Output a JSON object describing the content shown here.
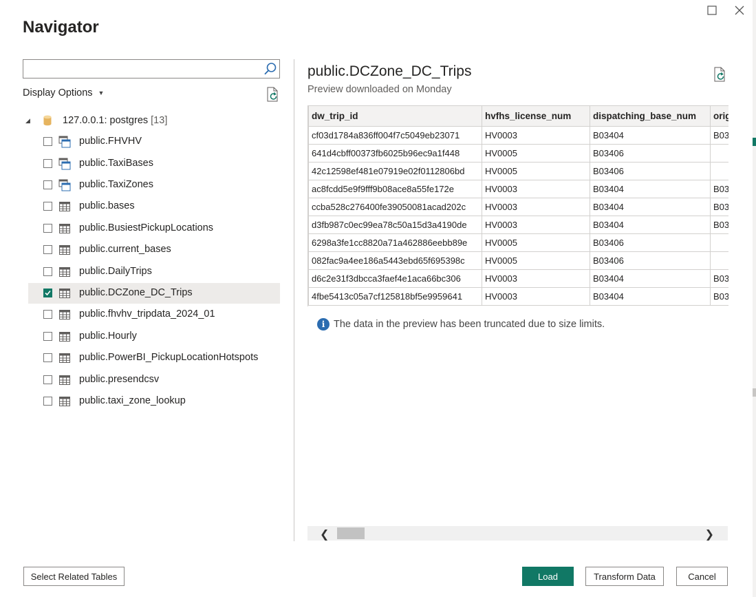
{
  "dialog": {
    "title": "Navigator"
  },
  "search": {
    "value": "",
    "placeholder": ""
  },
  "display_options": {
    "label": "Display Options"
  },
  "tree": {
    "root": {
      "label": "127.0.0.1: postgres",
      "count": "[13]"
    },
    "items": [
      {
        "label": "public.FHVHV",
        "icon": "view-icon",
        "checked": false
      },
      {
        "label": "public.TaxiBases",
        "icon": "view-icon",
        "checked": false
      },
      {
        "label": "public.TaxiZones",
        "icon": "view-icon",
        "checked": false
      },
      {
        "label": "public.bases",
        "icon": "table-icon",
        "checked": false
      },
      {
        "label": "public.BusiestPickupLocations",
        "icon": "table-icon",
        "checked": false
      },
      {
        "label": "public.current_bases",
        "icon": "table-icon",
        "checked": false
      },
      {
        "label": "public.DailyTrips",
        "icon": "table-icon",
        "checked": false
      },
      {
        "label": "public.DCZone_DC_Trips",
        "icon": "table-icon",
        "checked": true
      },
      {
        "label": "public.fhvhv_tripdata_2024_01",
        "icon": "table-icon",
        "checked": false
      },
      {
        "label": "public.Hourly",
        "icon": "table-icon",
        "checked": false
      },
      {
        "label": "public.PowerBI_PickupLocationHotspots",
        "icon": "table-icon",
        "checked": false
      },
      {
        "label": "public.presendcsv",
        "icon": "table-icon",
        "checked": false
      },
      {
        "label": "public.taxi_zone_lookup",
        "icon": "table-icon",
        "checked": false
      }
    ]
  },
  "preview": {
    "title": "public.DCZone_DC_Trips",
    "subtitle": "Preview downloaded on Monday",
    "columns": [
      "dw_trip_id",
      "hvfhs_license_num",
      "dispatching_base_num",
      "orig"
    ],
    "rows": [
      [
        "cf03d1784a836ff004f7c5049eb23071",
        "HV0003",
        "B03404",
        "B03"
      ],
      [
        "641d4cbff00373fb6025b96ec9a1f448",
        "HV0005",
        "B03406",
        ""
      ],
      [
        "42c12598ef481e07919e02f0112806bd",
        "HV0005",
        "B03406",
        ""
      ],
      [
        "ac8fcdd5e9f9fff9b08ace8a55fe172e",
        "HV0003",
        "B03404",
        "B03"
      ],
      [
        "ccba528c276400fe39050081acad202c",
        "HV0003",
        "B03404",
        "B03"
      ],
      [
        "d3fb987c0ec99ea78c50a15d3a4190de",
        "HV0003",
        "B03404",
        "B03"
      ],
      [
        "6298a3fe1cc8820a71a462886eebb89e",
        "HV0005",
        "B03406",
        ""
      ],
      [
        "082fac9a4ee186a5443ebd65f695398c",
        "HV0005",
        "B03406",
        ""
      ],
      [
        "d6c2e31f3dbcca3faef4e1aca66bc306",
        "HV0003",
        "B03404",
        "B03"
      ],
      [
        "4fbe5413c05a7cf125818bf5e9959641",
        "HV0003",
        "B03404",
        "B03"
      ]
    ],
    "truncation_notice": "The data in the preview has been truncated due to size limits."
  },
  "footer": {
    "select_related": "Select Related Tables",
    "load": "Load",
    "transform": "Transform Data",
    "cancel": "Cancel"
  },
  "colors": {
    "accent": "#117865",
    "info": "#2b6cb0"
  }
}
